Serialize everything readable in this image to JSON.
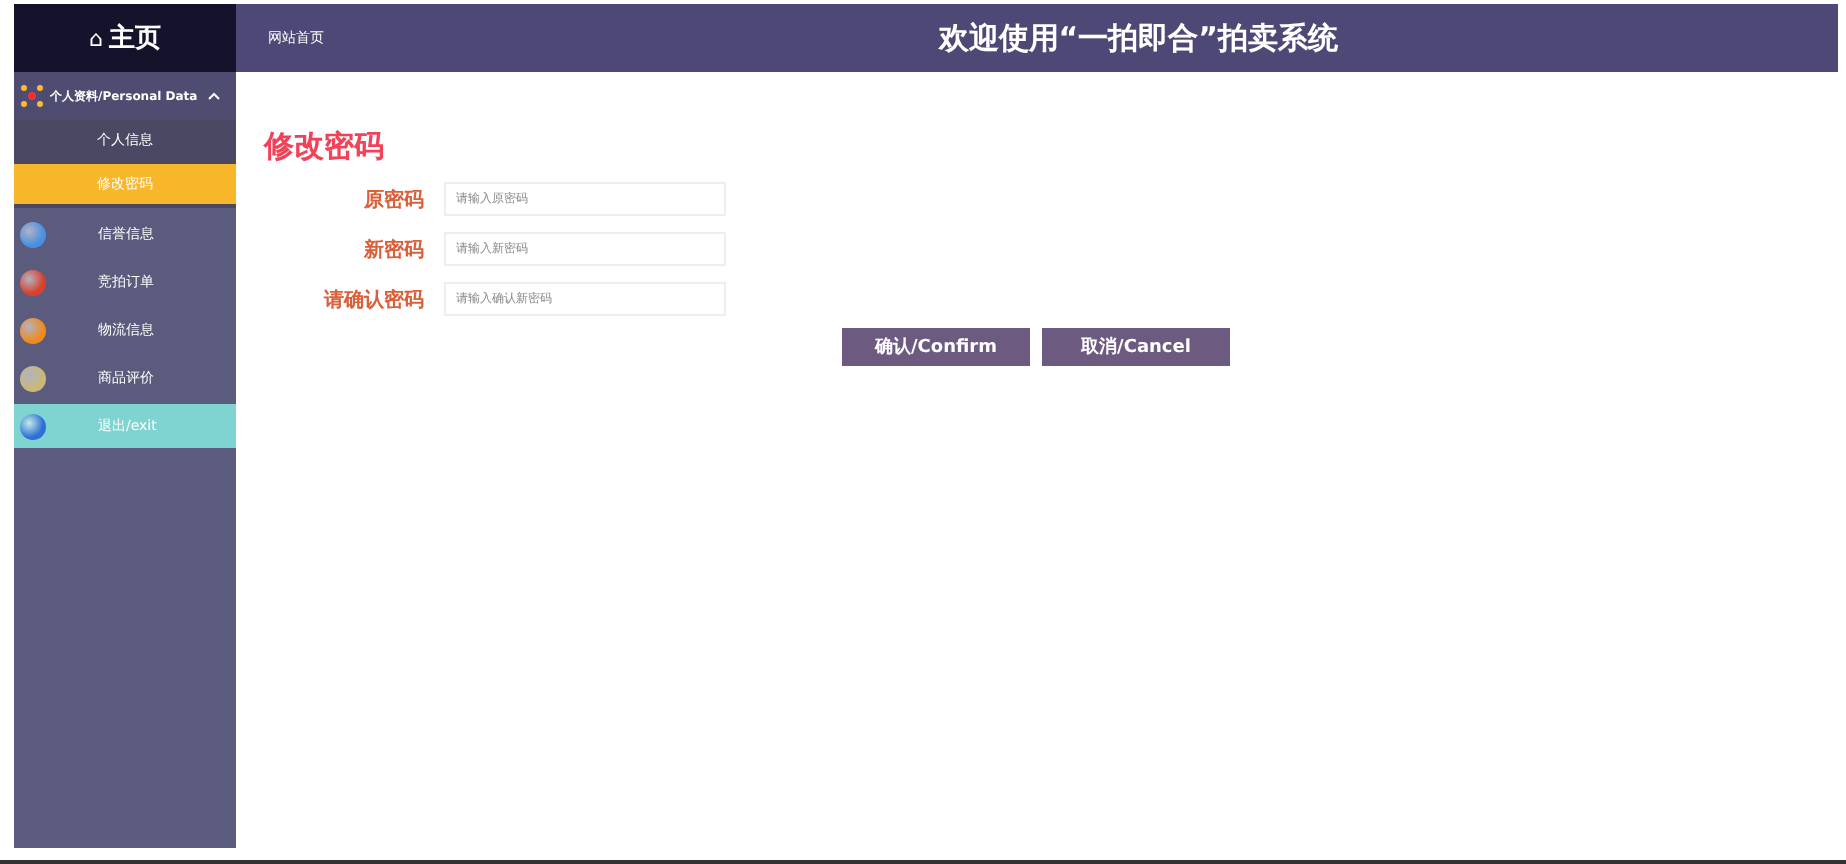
{
  "sidebar": {
    "home": {
      "icon": "⌂",
      "label": "主页"
    },
    "section": {
      "label": "个人资料/Personal Data",
      "expanded": true,
      "children": [
        {
          "label": "个人信息",
          "selected": false
        },
        {
          "label": "修改密码",
          "selected": true
        }
      ]
    },
    "items": [
      {
        "kind": "main",
        "label": "信誉信息",
        "color": "#4a90e2"
      },
      {
        "kind": "main",
        "label": "竞拍订单",
        "color": "#d9412b"
      },
      {
        "kind": "main",
        "label": "物流信息",
        "color": "#f08a1c"
      },
      {
        "kind": "main",
        "label": "商品评价",
        "color": "#c9b878"
      },
      {
        "kind": "exit",
        "label": "退出/exit",
        "color": "#2d6fd6"
      }
    ]
  },
  "header": {
    "link": "网站首页",
    "title": "欢迎使用“一拍即合”拍卖系统"
  },
  "form": {
    "title": "修改密码",
    "fields": [
      {
        "label": "原密码",
        "placeholder": "请输入原密码"
      },
      {
        "label": "新密码",
        "placeholder": "请输入新密码"
      },
      {
        "label": "请确认密码",
        "placeholder": "请输入确认新密码"
      }
    ],
    "buttons": [
      "确认/Confirm",
      "取消/Cancel"
    ]
  }
}
